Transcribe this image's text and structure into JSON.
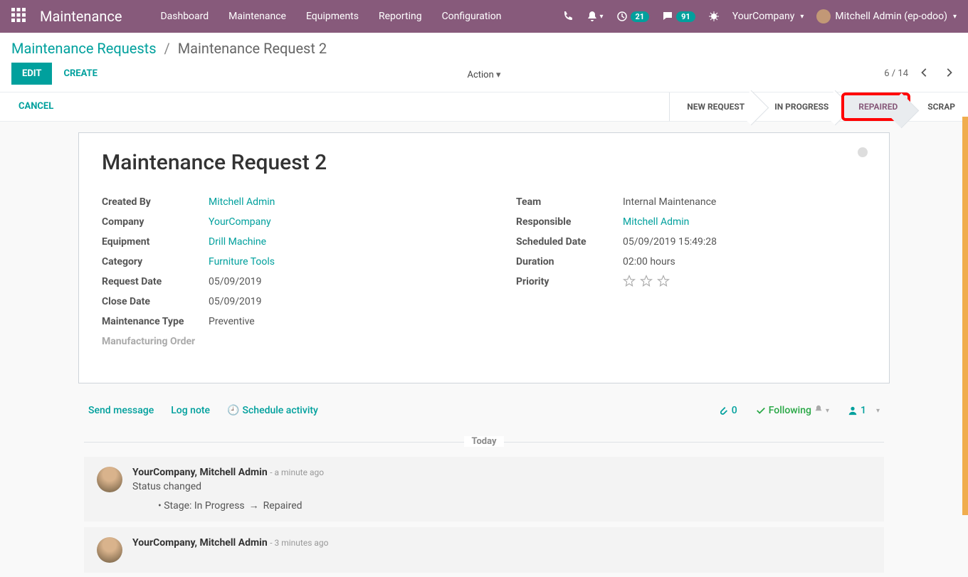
{
  "nav": {
    "brand": "Maintenance",
    "menu": [
      "Dashboard",
      "Maintenance",
      "Equipments",
      "Reporting",
      "Configuration"
    ],
    "badge1": "21",
    "badge2": "91",
    "company": "YourCompany",
    "user": "Mitchell Admin (ep-odoo)"
  },
  "breadcrumb": {
    "root": "Maintenance Requests",
    "current": "Maintenance Request 2"
  },
  "buttons": {
    "edit": "EDIT",
    "create": "CREATE",
    "action": "Action",
    "cancel": "CANCEL"
  },
  "pager": {
    "pos": "6 / 14"
  },
  "stages": [
    "NEW REQUEST",
    "IN PROGRESS",
    "REPAIRED",
    "SCRAP"
  ],
  "form": {
    "title": "Maintenance Request 2",
    "left": {
      "created_by_l": "Created By",
      "created_by": "Mitchell Admin",
      "company_l": "Company",
      "company": "YourCompany",
      "equipment_l": "Equipment",
      "equipment": "Drill Machine",
      "category_l": "Category",
      "category": "Furniture Tools",
      "request_date_l": "Request Date",
      "request_date": "05/09/2019",
      "close_date_l": "Close Date",
      "close_date": "05/09/2019",
      "mtype_l": "Maintenance Type",
      "mtype": "Preventive",
      "morder_l": "Manufacturing Order"
    },
    "right": {
      "team_l": "Team",
      "team": "Internal Maintenance",
      "responsible_l": "Responsible",
      "responsible": "Mitchell Admin",
      "scheduled_l": "Scheduled Date",
      "scheduled": "05/09/2019 15:49:28",
      "duration_l": "Duration",
      "duration": "02:00  hours",
      "priority_l": "Priority"
    }
  },
  "chatter": {
    "send": "Send message",
    "log": "Log note",
    "schedule": "Schedule activity",
    "attach": "0",
    "follow": "Following",
    "followers": "1",
    "today": "Today",
    "m1_author": "YourCompany, Mitchell Admin",
    "m1_time": " -  a minute ago",
    "m1_body": "Status changed",
    "m1_bullet_pre": "Stage: In Progress",
    "m1_bullet_post": "Repaired",
    "m2_author": "YourCompany, Mitchell Admin",
    "m2_time": " -  3 minutes ago"
  }
}
